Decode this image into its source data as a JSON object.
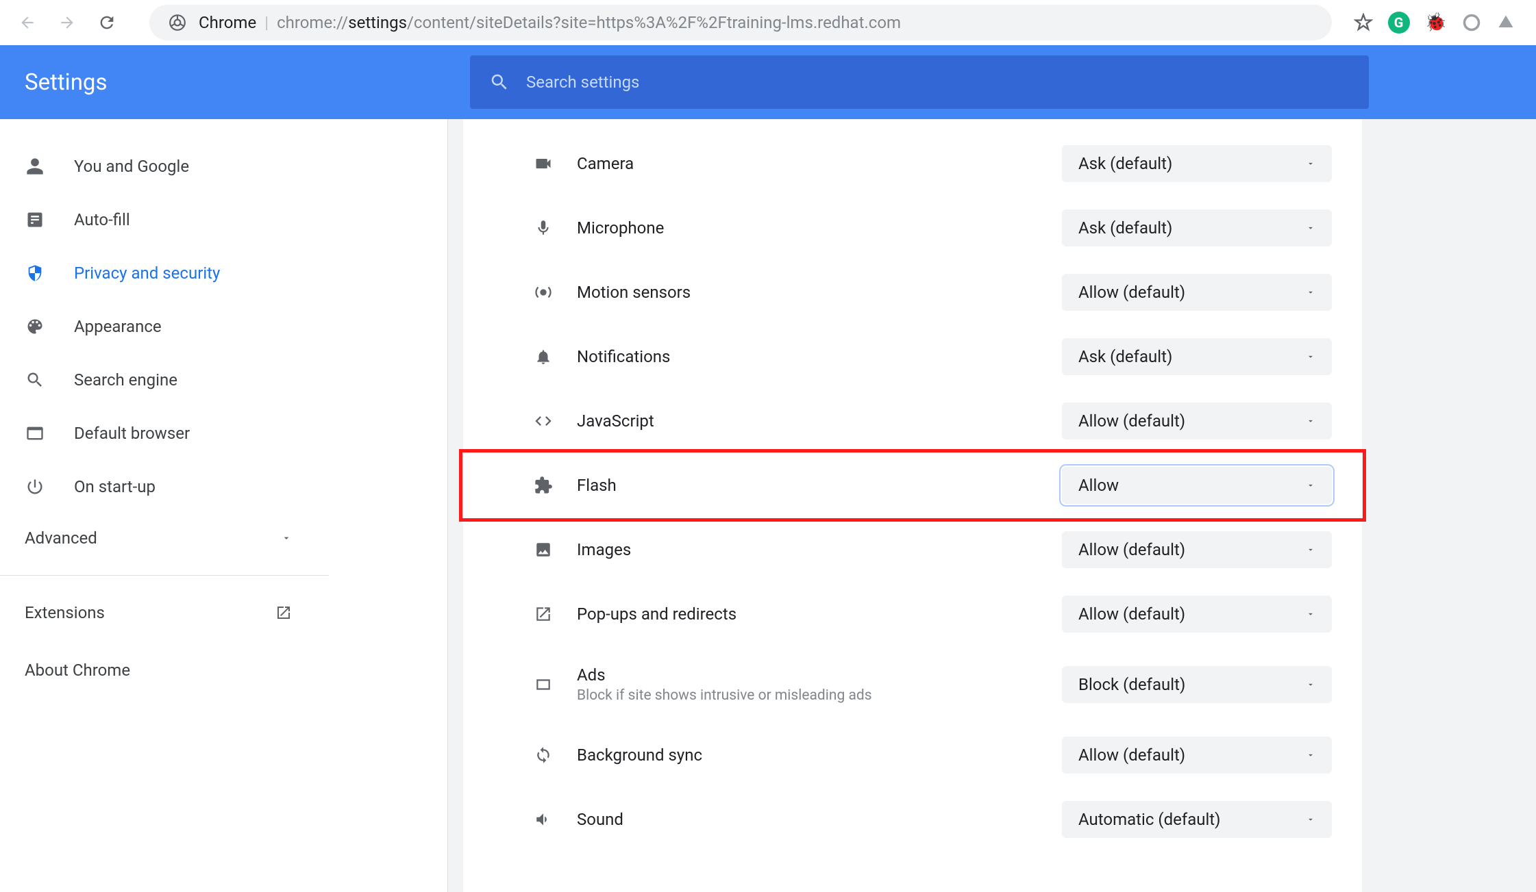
{
  "toolbar": {
    "url_label": "Chrome",
    "url_prefix": "chrome://",
    "url_bold": "settings",
    "url_rest": "/content/siteDetails?site=https%3A%2F%2Ftraining-lms.redhat.com"
  },
  "header": {
    "title": "Settings",
    "search_placeholder": "Search settings"
  },
  "sidebar": {
    "items": [
      {
        "label": "You and Google",
        "icon": "person"
      },
      {
        "label": "Auto-fill",
        "icon": "autofill"
      },
      {
        "label": "Privacy and security",
        "icon": "shield",
        "active": true
      },
      {
        "label": "Appearance",
        "icon": "palette"
      },
      {
        "label": "Search engine",
        "icon": "search"
      },
      {
        "label": "Default browser",
        "icon": "browser"
      },
      {
        "label": "On start-up",
        "icon": "power"
      }
    ],
    "advanced_label": "Advanced",
    "extensions_label": "Extensions",
    "about_label": "About Chrome"
  },
  "permissions": [
    {
      "icon": "camera",
      "label": "Camera",
      "value": "Ask (default)"
    },
    {
      "icon": "mic",
      "label": "Microphone",
      "value": "Ask (default)"
    },
    {
      "icon": "motion",
      "label": "Motion sensors",
      "value": "Allow (default)"
    },
    {
      "icon": "bell",
      "label": "Notifications",
      "value": "Ask (default)"
    },
    {
      "icon": "code",
      "label": "JavaScript",
      "value": "Allow (default)"
    },
    {
      "icon": "plugin",
      "label": "Flash",
      "value": "Allow",
      "highlighted": true,
      "focused": true
    },
    {
      "icon": "image",
      "label": "Images",
      "value": "Allow (default)"
    },
    {
      "icon": "popup",
      "label": "Pop-ups and redirects",
      "value": "Allow (default)"
    },
    {
      "icon": "ads",
      "label": "Ads",
      "sublabel": "Block if site shows intrusive or misleading ads",
      "value": "Block (default)"
    },
    {
      "icon": "sync",
      "label": "Background sync",
      "value": "Allow (default)"
    },
    {
      "icon": "sound",
      "label": "Sound",
      "value": "Automatic (default)"
    }
  ]
}
